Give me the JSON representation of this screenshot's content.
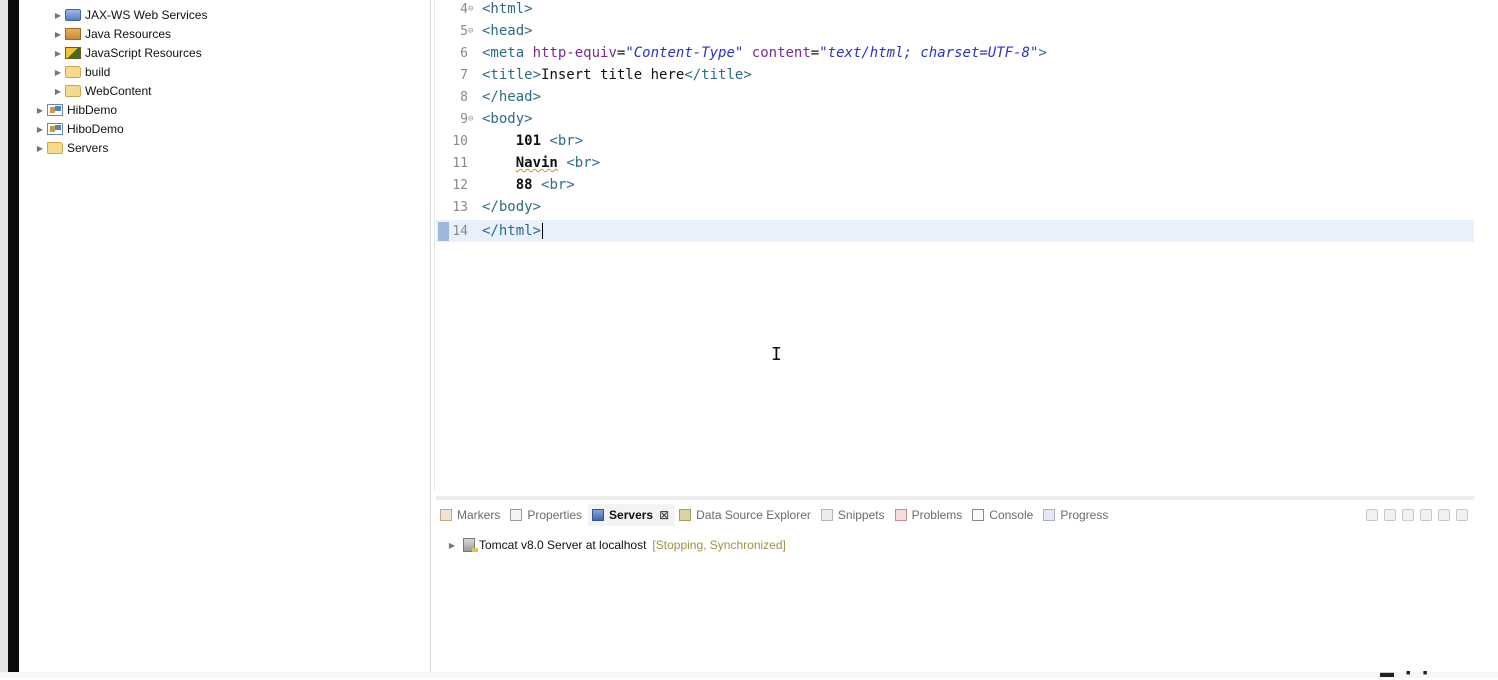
{
  "explorer": {
    "items": [
      {
        "label": "JAX-WS Web Services",
        "icon": "jaxws-icon"
      },
      {
        "label": "Java Resources",
        "icon": "java-resources-icon"
      },
      {
        "label": "JavaScript Resources",
        "icon": "javascript-resources-icon"
      },
      {
        "label": "build",
        "icon": "folder-icon"
      },
      {
        "label": "WebContent",
        "icon": "folder-icon"
      },
      {
        "label": "HibDemo",
        "icon": "project-icon"
      },
      {
        "label": "HiboDemo",
        "icon": "project-icon"
      },
      {
        "label": "Servers",
        "icon": "folder-icon"
      }
    ]
  },
  "editor": {
    "lines": [
      {
        "num": "5",
        "text": "<head>"
      },
      {
        "num": "6",
        "text": "<meta http-equiv=\"Content-Type\" content=\"text/html; charset=UTF-8\">"
      },
      {
        "num": "7",
        "text": "<title>Insert title here</title>"
      },
      {
        "num": "8",
        "text": "</head>"
      },
      {
        "num": "9",
        "text": "<body>"
      },
      {
        "num": "10",
        "text": "101 <br>"
      },
      {
        "num": "11",
        "text": "Navin <br>"
      },
      {
        "num": "12",
        "text": "88 <br>"
      },
      {
        "num": "13",
        "text": "</body>"
      },
      {
        "num": "14",
        "text": "</html>"
      }
    ],
    "tokens": {
      "l5_tag": "<head>",
      "l6_tag_open": "<meta",
      "l6_attr1": "http-equiv",
      "l6_eq1": "=",
      "l6_val1": "\"Content-Type\"",
      "l6_attr2": "content",
      "l6_eq2": "=",
      "l6_val2": "\"text/html; charset=UTF-8\"",
      "l6_tag_close": ">",
      "l7_tag_open": "<title>",
      "l7_text": "Insert title here",
      "l7_tag_close": "</title>",
      "l8_tag": "</head>",
      "l9_tag": "<body>",
      "l10_text": "101",
      "l10_tag": "<br>",
      "l11_text": "Navin",
      "l11_tag": "<br>",
      "l12_text": "88",
      "l12_tag": "<br>",
      "l13_tag": "</body>",
      "l14_tag": "</html>"
    }
  },
  "panel": {
    "tabs": [
      {
        "label": "Markers",
        "icon": "markers-icon"
      },
      {
        "label": "Properties",
        "icon": "properties-icon"
      },
      {
        "label": "Servers",
        "icon": "servers-icon",
        "active": true
      },
      {
        "label": "Data Source Explorer",
        "icon": "data-source-icon"
      },
      {
        "label": "Snippets",
        "icon": "snippets-icon"
      },
      {
        "label": "Problems",
        "icon": "problems-icon"
      },
      {
        "label": "Console",
        "icon": "console-icon"
      },
      {
        "label": "Progress",
        "icon": "progress-icon"
      }
    ],
    "close_glyph": "⊠",
    "server": {
      "name": "Tomcat v8.0 Server at localhost",
      "status": "[Stopping, Synchronized]"
    }
  },
  "colors": {
    "tag": "#2d6b86",
    "attribute": "#7b2b93",
    "value": "#2a32c8",
    "current_line": "#e8f0fb",
    "server_status": "#a38f48"
  }
}
